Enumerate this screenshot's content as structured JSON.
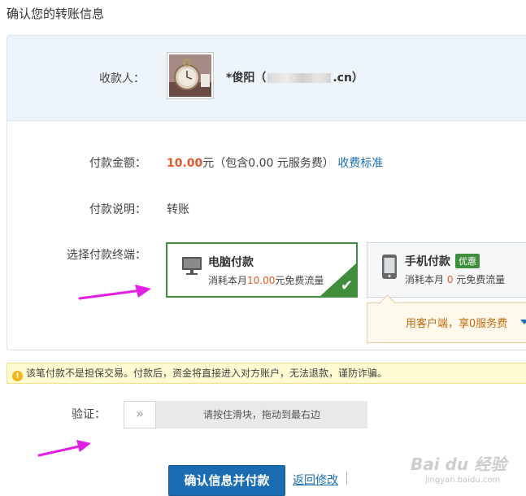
{
  "page": {
    "title": "确认您的转账信息"
  },
  "payee": {
    "label": "收款人：",
    "name_prefix": "*俊阳（",
    "name_suffix": ".cn）"
  },
  "payment": {
    "amount_label": "付款金额：",
    "amount_value": "10.00",
    "amount_unit": "元",
    "fee_note": "（包含0.00 元服务费）",
    "fee_link": "收费标准",
    "desc_label": "付款说明：",
    "desc_value": "转账"
  },
  "terminal": {
    "label": "选择付款终端：",
    "pc": {
      "title": "电脑付款",
      "sub_prefix": "消耗本月",
      "sub_value": "10.00",
      "sub_suffix": "元免费流量",
      "selected": true,
      "icon": "monitor-icon"
    },
    "mobile": {
      "title": "手机付款",
      "badge": "优惠",
      "sub_prefix": "消耗本月 ",
      "sub_value": "0",
      "sub_suffix": " 元免费流量",
      "icon": "phone-icon"
    },
    "promo_text": "用客户端，享0服务费"
  },
  "warning": {
    "icon": "!",
    "text": "该笔付款不是担保交易。付款后，资金将直接进入对方账户，无法退款，谨防诈骗。"
  },
  "verify": {
    "label": "验证：",
    "handle_glyph": "»",
    "hint": "请按住滑块，拖动到最右边"
  },
  "actions": {
    "confirm": "确认信息并付款",
    "back": "返回修改"
  },
  "watermark": {
    "text": "Bai du 经验",
    "sub": "jingyan.baidu.com"
  },
  "colors": {
    "accent_blue": "#1a6db3",
    "selected_green": "#3e8e3b",
    "amount_orange": "#e2592a",
    "annotation_magenta": "#e41fe4"
  }
}
